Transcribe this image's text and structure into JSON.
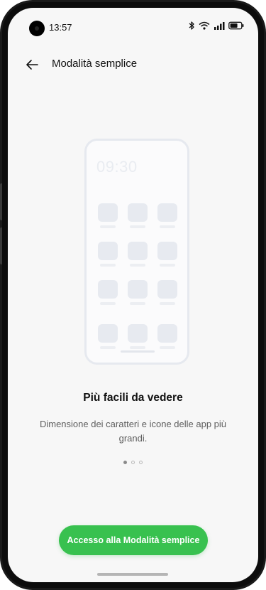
{
  "status_bar": {
    "time": "13:57",
    "icons": [
      "bluetooth-icon",
      "wifi-icon",
      "signal-icon",
      "battery-icon"
    ]
  },
  "header": {
    "back_icon": "arrow-left-icon",
    "title": "Modalità semplice"
  },
  "illustration": {
    "clock": "09:30",
    "app_rows": 4,
    "app_cols": 3
  },
  "content": {
    "headline": "Più facili da vedere",
    "description": "Dimensione dei caratteri e icone delle app più grandi."
  },
  "pager": {
    "total": 3,
    "active": 1
  },
  "actions": {
    "primary_label": "Accesso alla Modalità semplice"
  },
  "colors": {
    "accent": "#38c14f",
    "background": "#f7f7f7",
    "text_primary": "#111111",
    "text_secondary": "#5e5e5e"
  }
}
